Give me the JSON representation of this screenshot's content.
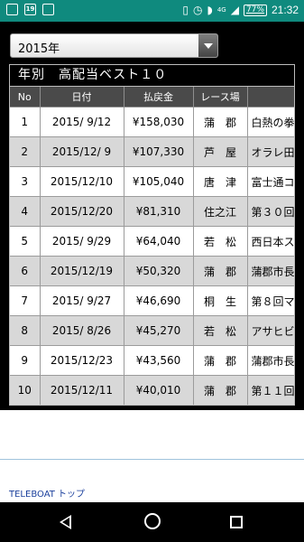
{
  "statusbar": {
    "left_icons": [
      "sim-icon",
      "calendar-icon",
      "photo-icon"
    ],
    "calendar_day": "19",
    "network": "4G",
    "battery": "77%",
    "time": "21:32"
  },
  "year_select": {
    "value": "2015年"
  },
  "ranking": {
    "title": "年別　高配当ベスト１０",
    "headers": [
      "No",
      "日付",
      "払戻金",
      "レース場",
      ""
    ],
    "rows": [
      {
        "no": "1",
        "date": "2015/ 9/12",
        "payout": "¥158,030",
        "place": "蒲　郡",
        "race": "白熱の拳"
      },
      {
        "no": "2",
        "date": "2015/12/ 9",
        "payout": "¥107,330",
        "place": "芦　屋",
        "race": "オラレ田"
      },
      {
        "no": "3",
        "date": "2015/12/10",
        "payout": "¥105,040",
        "place": "唐　津",
        "race": "富士通コ"
      },
      {
        "no": "4",
        "date": "2015/12/20",
        "payout": "¥81,310",
        "place": "住之江",
        "race": "第３０回"
      },
      {
        "no": "5",
        "date": "2015/ 9/29",
        "payout": "¥64,040",
        "place": "若　松",
        "race": "西日本ス"
      },
      {
        "no": "6",
        "date": "2015/12/19",
        "payout": "¥50,320",
        "place": "蒲　郡",
        "race": "蒲郡市長"
      },
      {
        "no": "7",
        "date": "2015/ 9/27",
        "payout": "¥46,690",
        "place": "桐　生",
        "race": "第８回マ"
      },
      {
        "no": "8",
        "date": "2015/ 8/26",
        "payout": "¥45,270",
        "place": "若　松",
        "race": "アサヒビ"
      },
      {
        "no": "9",
        "date": "2015/12/23",
        "payout": "¥43,560",
        "place": "蒲　郡",
        "race": "蒲郡市長"
      },
      {
        "no": "10",
        "date": "2015/12/11",
        "payout": "¥40,010",
        "place": "蒲　郡",
        "race": "第１１回"
      }
    ]
  },
  "footer": {
    "link": "TELEBOAT トップ"
  },
  "navbar": {
    "buttons": [
      "back-icon",
      "home-icon",
      "recent-apps-icon"
    ]
  }
}
